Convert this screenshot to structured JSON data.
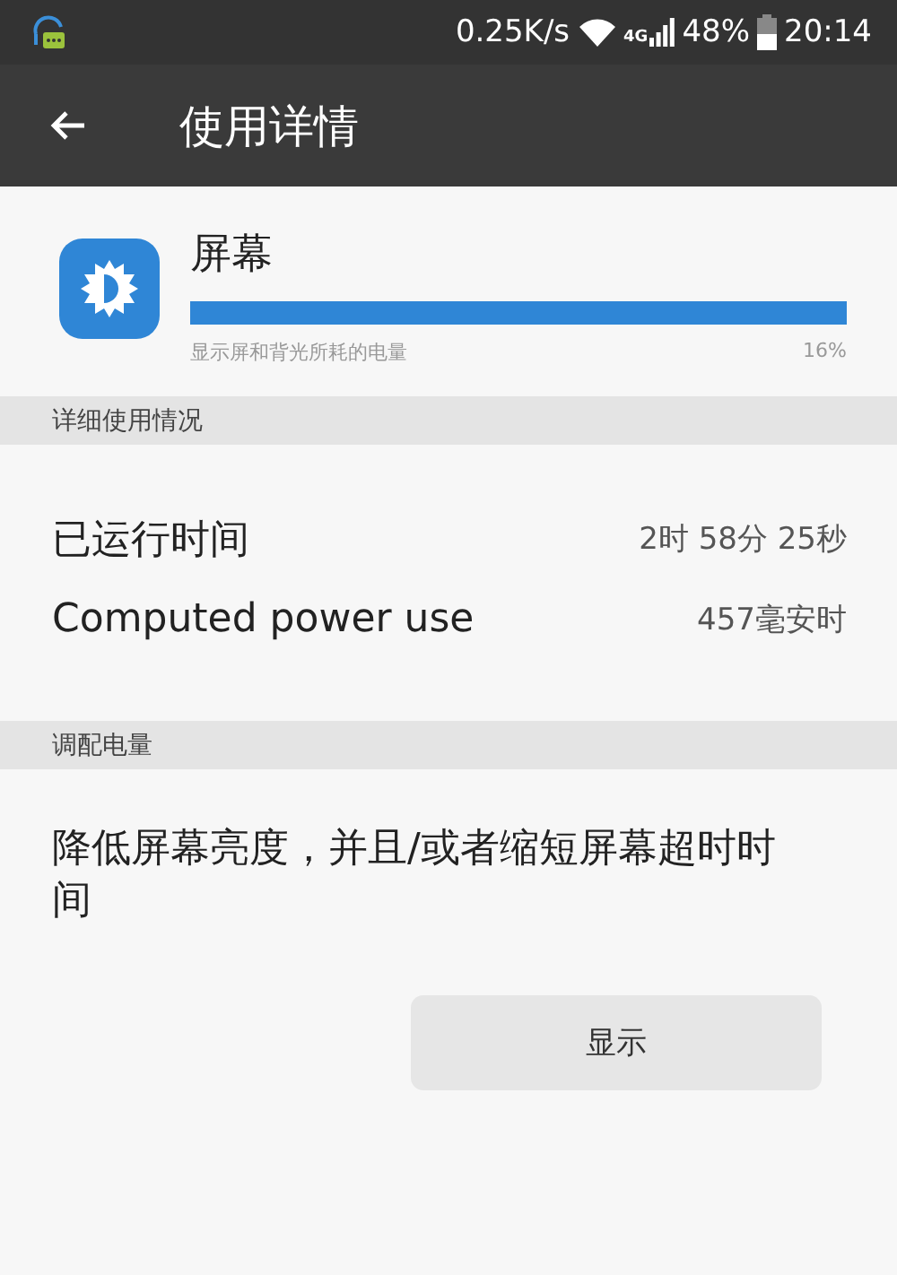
{
  "status_bar": {
    "speed": "0.25K/s",
    "network": "4G",
    "battery": "48%",
    "time": "20:14"
  },
  "app_bar": {
    "title": "使用详情"
  },
  "header": {
    "title": "屏幕",
    "level": 1,
    "description": "显示屏和背光所耗的电量",
    "percent": "16%"
  },
  "sections": [
    {
      "title": "详细使用情况",
      "kind": "details",
      "rows": [
        {
          "label": "已运行时间",
          "value": "2时 58分 25秒"
        },
        {
          "label": "Computed power use",
          "value": "457毫安时"
        }
      ]
    },
    {
      "title": "调配电量",
      "kind": "tip",
      "text": "降低屏幕亮度，并且/或者缩短屏幕超时时间",
      "button": "显示"
    }
  ]
}
